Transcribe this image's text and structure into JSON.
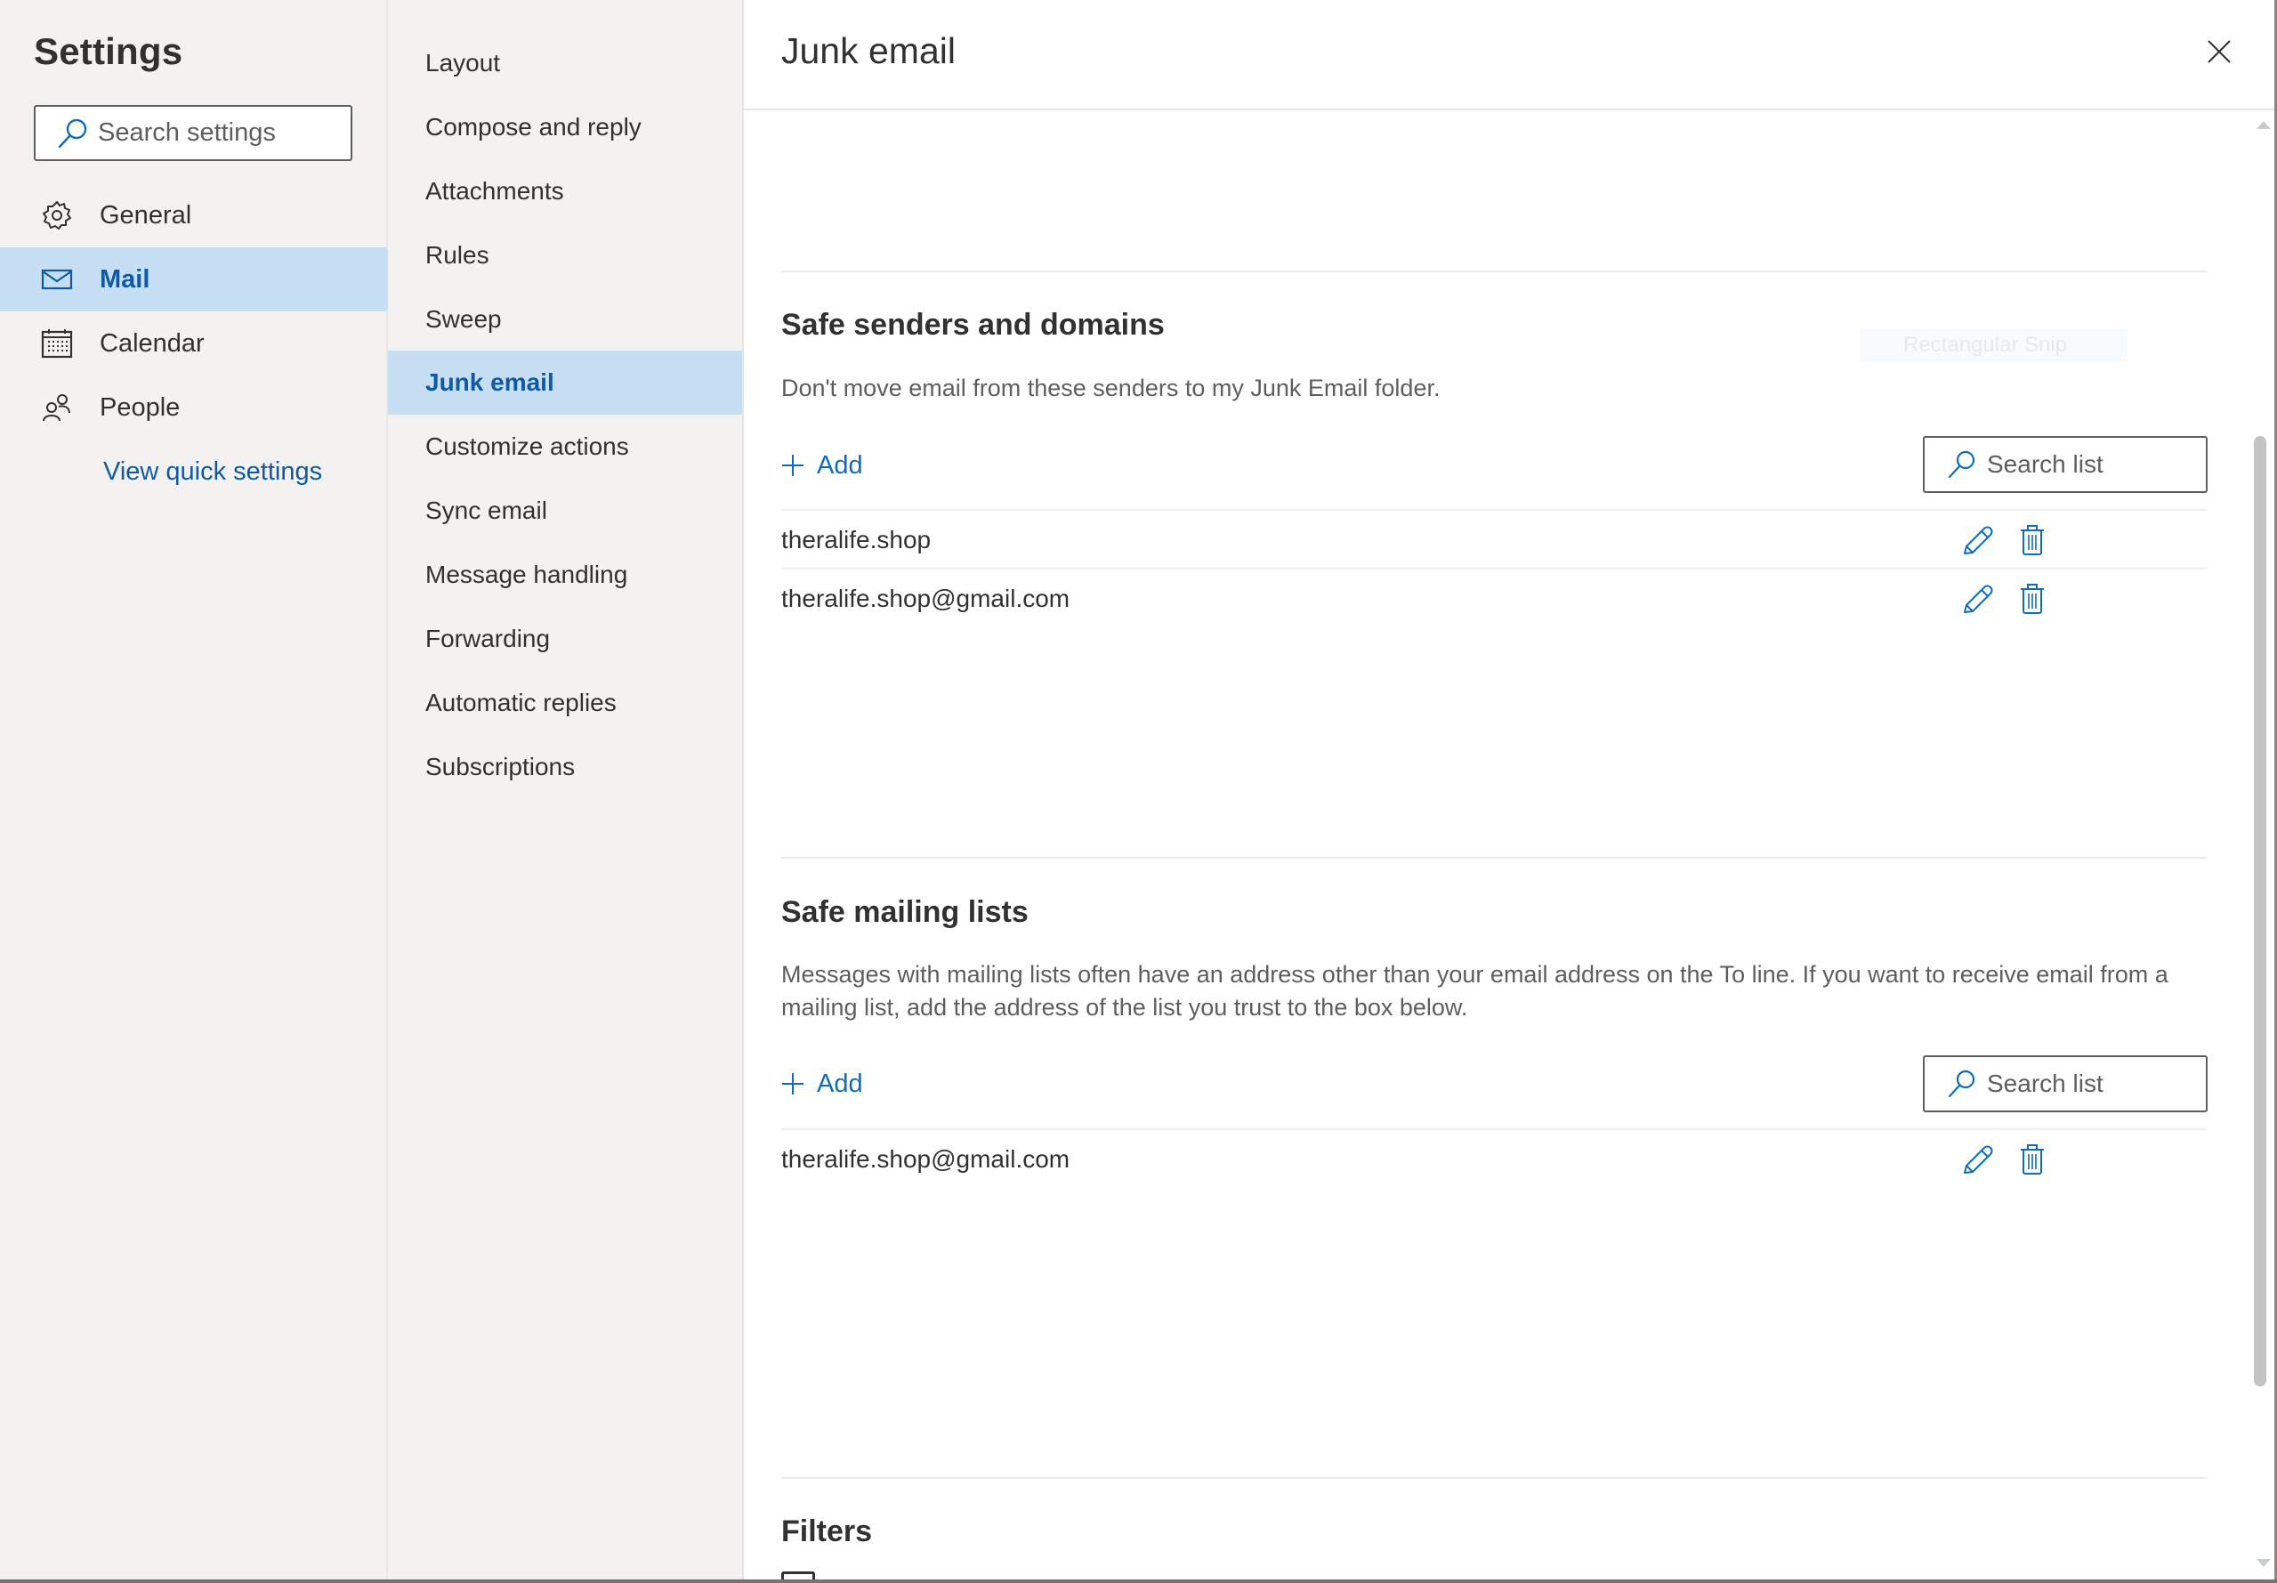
{
  "settings": {
    "title": "Settings",
    "search_placeholder": "Search settings",
    "nav": [
      {
        "label": "General",
        "icon": "gear-icon",
        "active": false
      },
      {
        "label": "Mail",
        "icon": "mail-icon",
        "active": true
      },
      {
        "label": "Calendar",
        "icon": "calendar-icon",
        "active": false
      },
      {
        "label": "People",
        "icon": "people-icon",
        "active": false
      }
    ],
    "quick_settings_link": "View quick settings"
  },
  "mail_nav": {
    "items": [
      {
        "label": "Layout",
        "active": false
      },
      {
        "label": "Compose and reply",
        "active": false
      },
      {
        "label": "Attachments",
        "active": false
      },
      {
        "label": "Rules",
        "active": false
      },
      {
        "label": "Sweep",
        "active": false
      },
      {
        "label": "Junk email",
        "active": true
      },
      {
        "label": "Customize actions",
        "active": false
      },
      {
        "label": "Sync email",
        "active": false
      },
      {
        "label": "Message handling",
        "active": false
      },
      {
        "label": "Forwarding",
        "active": false
      },
      {
        "label": "Automatic replies",
        "active": false
      },
      {
        "label": "Subscriptions",
        "active": false
      }
    ]
  },
  "panel": {
    "title": "Junk email",
    "close_icon": "close-icon",
    "snip_overlay_text": "Rectangular Snip",
    "safe_senders": {
      "heading": "Safe senders and domains",
      "description": "Don't move email from these senders to my Junk Email folder.",
      "add_label": "Add",
      "search_placeholder": "Search list",
      "entries": [
        "theralife.shop",
        "theralife.shop@gmail.com"
      ]
    },
    "safe_mailing_lists": {
      "heading": "Safe mailing lists",
      "description": "Messages with mailing lists often have an address other than your email address on the To line. If you want to receive email from a mailing list, add the address of the list you trust to the box below.",
      "add_label": "Add",
      "search_placeholder": "Search list",
      "entries": [
        "theralife.shop@gmail.com"
      ]
    },
    "filters": {
      "heading": "Filters"
    }
  },
  "colors": {
    "accent": "#0f6cbd",
    "selected_bg": "#c7dff4",
    "selected_text": "#0f5aa3",
    "sidebar_bg": "#f3f2f1"
  }
}
